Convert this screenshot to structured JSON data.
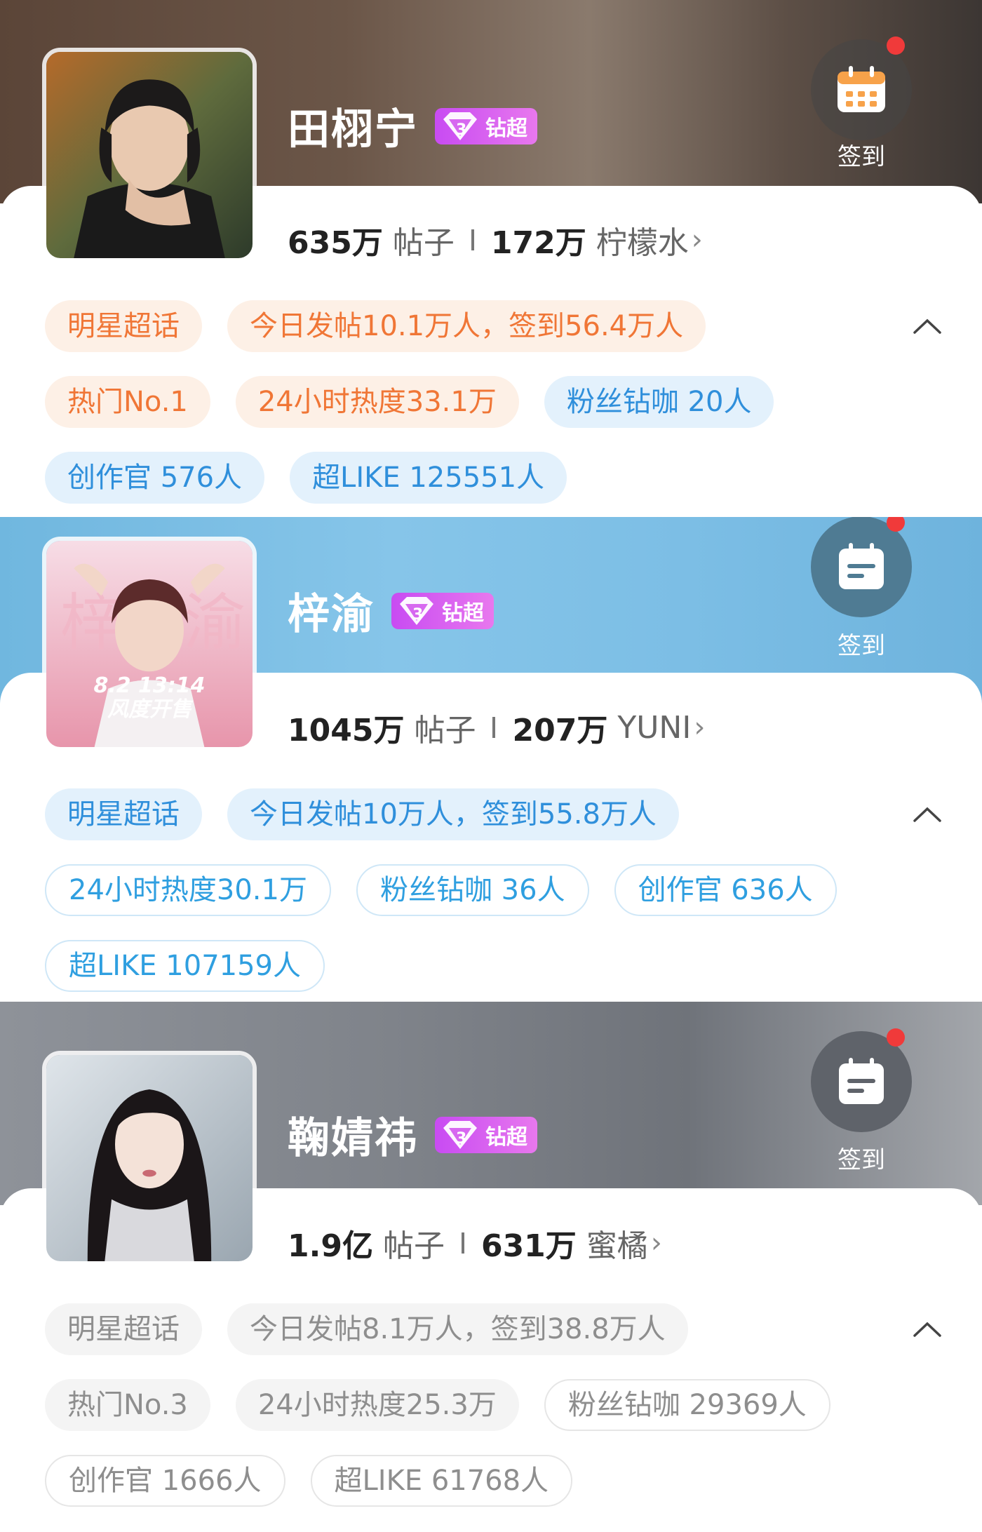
{
  "cards": [
    {
      "name": "田栩宁",
      "badge": "钻超",
      "checkin": "签到",
      "posts_num": "635万",
      "posts_label": "帖子",
      "fans_num": "172万",
      "fans_label": "柠檬水",
      "tags": [
        [
          "明星超话",
          "今日发帖10.1万人，签到56.4万人"
        ],
        [
          "热门No.1",
          "24小时热度33.1万",
          "粉丝钻咖 20人"
        ],
        [
          "创作官 576人",
          "超LIKE 125551人"
        ]
      ]
    },
    {
      "name": "梓渝",
      "badge": "钻超",
      "checkin": "签到",
      "posts_num": "1045万",
      "posts_label": "帖子",
      "fans_num": "207万",
      "fans_label": "YUNI",
      "avatar_text_1": "8.2 13:14",
      "avatar_text_2": "风度开售",
      "tags": [
        [
          "明星超话",
          "今日发帖10万人，签到55.8万人"
        ],
        [
          "24小时热度30.1万",
          "粉丝钻咖 36人",
          "创作官 636人"
        ],
        [
          "超LIKE 107159人"
        ]
      ]
    },
    {
      "name": "鞠婧祎",
      "badge": "钻超",
      "checkin": "签到",
      "posts_num": "1.9亿",
      "posts_label": "帖子",
      "fans_num": "631万",
      "fans_label": "蜜橘",
      "tags": [
        [
          "明星超话",
          "今日发帖8.1万人，签到38.8万人"
        ],
        [
          "热门No.3",
          "24小时热度25.3万",
          "粉丝钻咖 29369人"
        ],
        [
          "创作官 1666人",
          "超LIKE 61768人"
        ]
      ]
    }
  ],
  "colors": {
    "orange_tag_text": "#f07636",
    "blue_tag_text": "#2f8fdb",
    "grey_tag_text": "#8e8e8e",
    "badge_purple": "#c84bf2",
    "notify_dot": "#f03a3a"
  },
  "icons": [
    "calendar-icon",
    "chevron-right-icon",
    "chevron-up-icon",
    "diamond-badge-icon"
  ]
}
